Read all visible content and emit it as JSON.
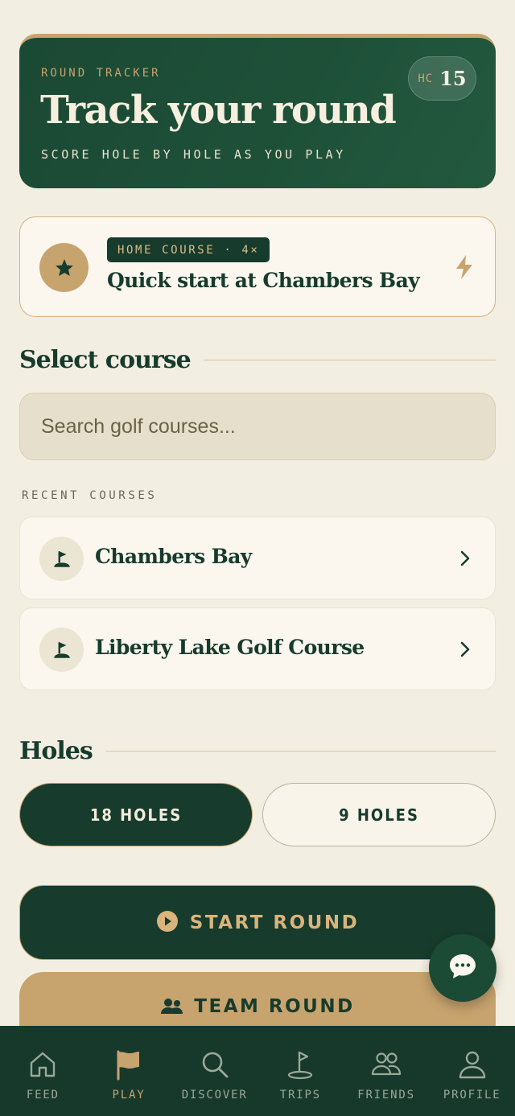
{
  "hero": {
    "eyebrow": "ROUND TRACKER",
    "title": "Track your round",
    "subtitle": "SCORE HOLE BY HOLE AS YOU PLAY",
    "handicap_label": "HC",
    "handicap_value": "15"
  },
  "quick_start": {
    "tag": "HOME COURSE · 4×",
    "title": "Quick start at Chambers Bay",
    "icon": "star-icon",
    "action_icon": "bolt-icon"
  },
  "select_course": {
    "heading": "Select course",
    "search_placeholder": "Search golf courses...",
    "recent_label": "RECENT COURSES",
    "recent": [
      {
        "name": "Chambers Bay",
        "icon": "golf-flag-icon"
      },
      {
        "name": "Liberty Lake Golf Course",
        "icon": "golf-flag-icon"
      }
    ]
  },
  "holes": {
    "heading": "Holes",
    "options": [
      {
        "label": "18 HOLES",
        "selected": true
      },
      {
        "label": "9 HOLES",
        "selected": false
      }
    ]
  },
  "actions": {
    "start_label": "START ROUND",
    "team_label": "TEAM ROUND"
  },
  "chat": {
    "icon": "chat-bubble-icon"
  },
  "nav": {
    "items": [
      {
        "label": "FEED",
        "icon": "home-icon",
        "active": false
      },
      {
        "label": "PLAY",
        "icon": "flag-icon",
        "active": true
      },
      {
        "label": "DISCOVER",
        "icon": "search-icon",
        "active": false
      },
      {
        "label": "TRIPS",
        "icon": "golf-pin-icon",
        "active": false
      },
      {
        "label": "FRIENDS",
        "icon": "friends-icon",
        "active": false
      },
      {
        "label": "PROFILE",
        "icon": "profile-icon",
        "active": false
      }
    ]
  },
  "colors": {
    "forest": "#173b2c",
    "gold": "#c7a36e",
    "cream": "#f3eee2",
    "card": "#fbf7ee"
  }
}
